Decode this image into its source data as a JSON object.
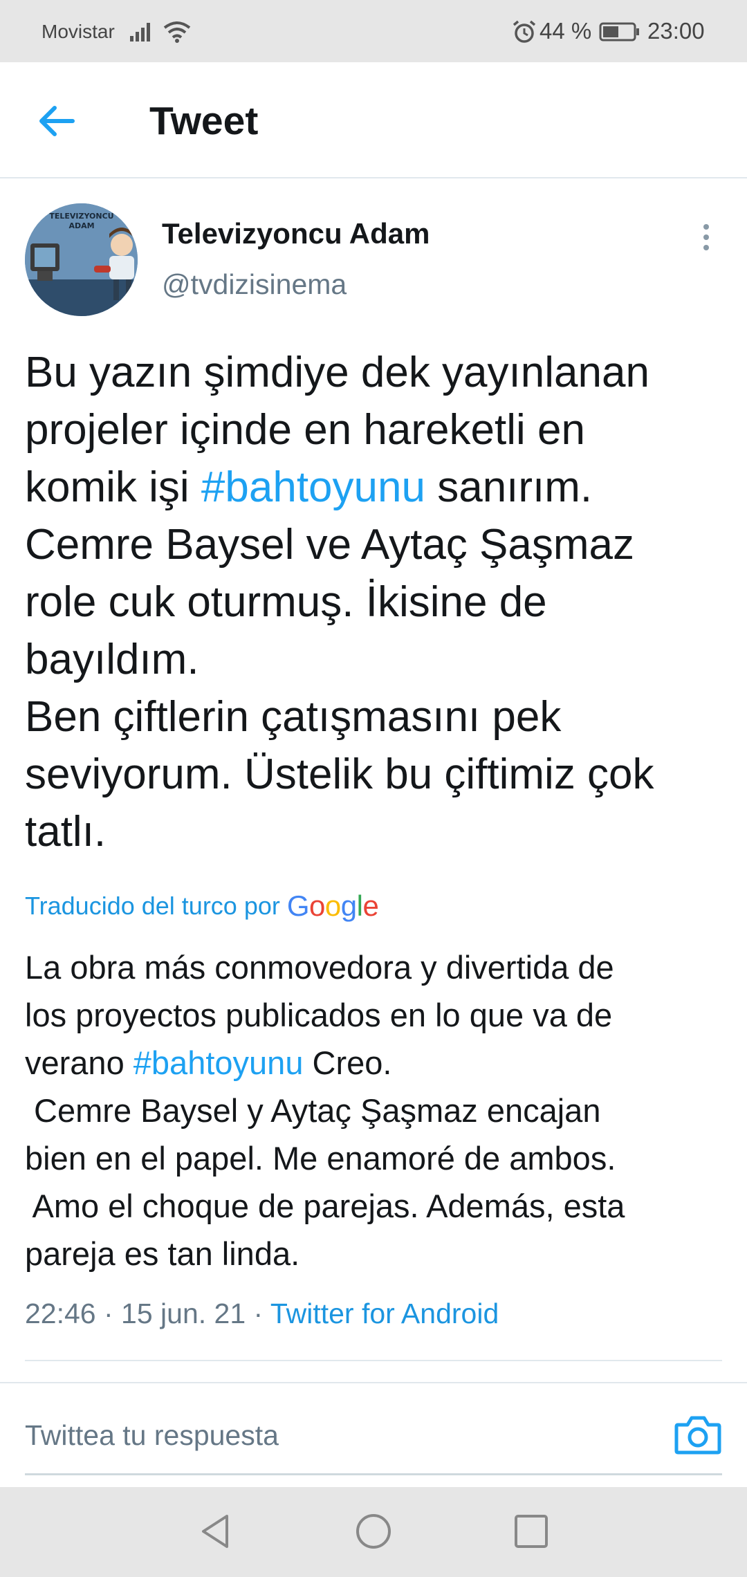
{
  "status_bar": {
    "carrier": "Movistar",
    "battery_percent": "44 %",
    "time": "23:00",
    "icons": [
      "signal-icon",
      "wifi-icon",
      "alarm-icon",
      "battery-icon"
    ]
  },
  "header": {
    "title": "Tweet",
    "back_icon": "arrow-left-icon"
  },
  "tweet": {
    "author": {
      "display_name": "Televizyoncu Adam",
      "handle": "@tvdizisinema",
      "avatar_text_1": "TELEVIZYONCU",
      "avatar_text_2": "ADAM"
    },
    "text_lines": [
      "Bu yazın şimdiye dek yayınlanan",
      "projeler içinde en hareketli en",
      "komik işi ",
      "#bahtoyunu",
      " sanırım.",
      "Cemre Baysel ve Aytaç Şaşmaz",
      "role cuk oturmuş. İkisine de",
      "bayıldım.",
      "Ben çiftlerin çatışmasını pek",
      "seviyorum. Üstelik bu çiftimiz çok",
      "tatlı."
    ],
    "translated_by": "Traducido del turco por",
    "google_letters": [
      "G",
      "o",
      "o",
      "g",
      "l",
      "e"
    ],
    "google_colors": [
      "#4285F4",
      "#EA4335",
      "#FBBC05",
      "#4285F4",
      "#34A853",
      "#EA4335"
    ],
    "translation_lines": [
      "La obra más conmovedora y divertida de",
      "los proyectos publicados en lo que va de",
      "verano ",
      "#bahtoyunu",
      " Creo.",
      " Cemre Baysel y Aytaç Şaşmaz encajan",
      "bien en el papel. Me enamoré de ambos.",
      " Amo el choque de parejas. Además, esta",
      "pareja es tan linda."
    ],
    "timestamp": "22:46 · 15 jun. 21 · ",
    "source": "Twitter for Android"
  },
  "reply": {
    "placeholder": "Twittea tu respuesta",
    "camera_icon": "camera-icon"
  },
  "colors": {
    "accent": "#1da1f2",
    "link": "#1b95e0",
    "secondary_text": "#657786",
    "status_bar_bg": "#e6e6e6"
  }
}
